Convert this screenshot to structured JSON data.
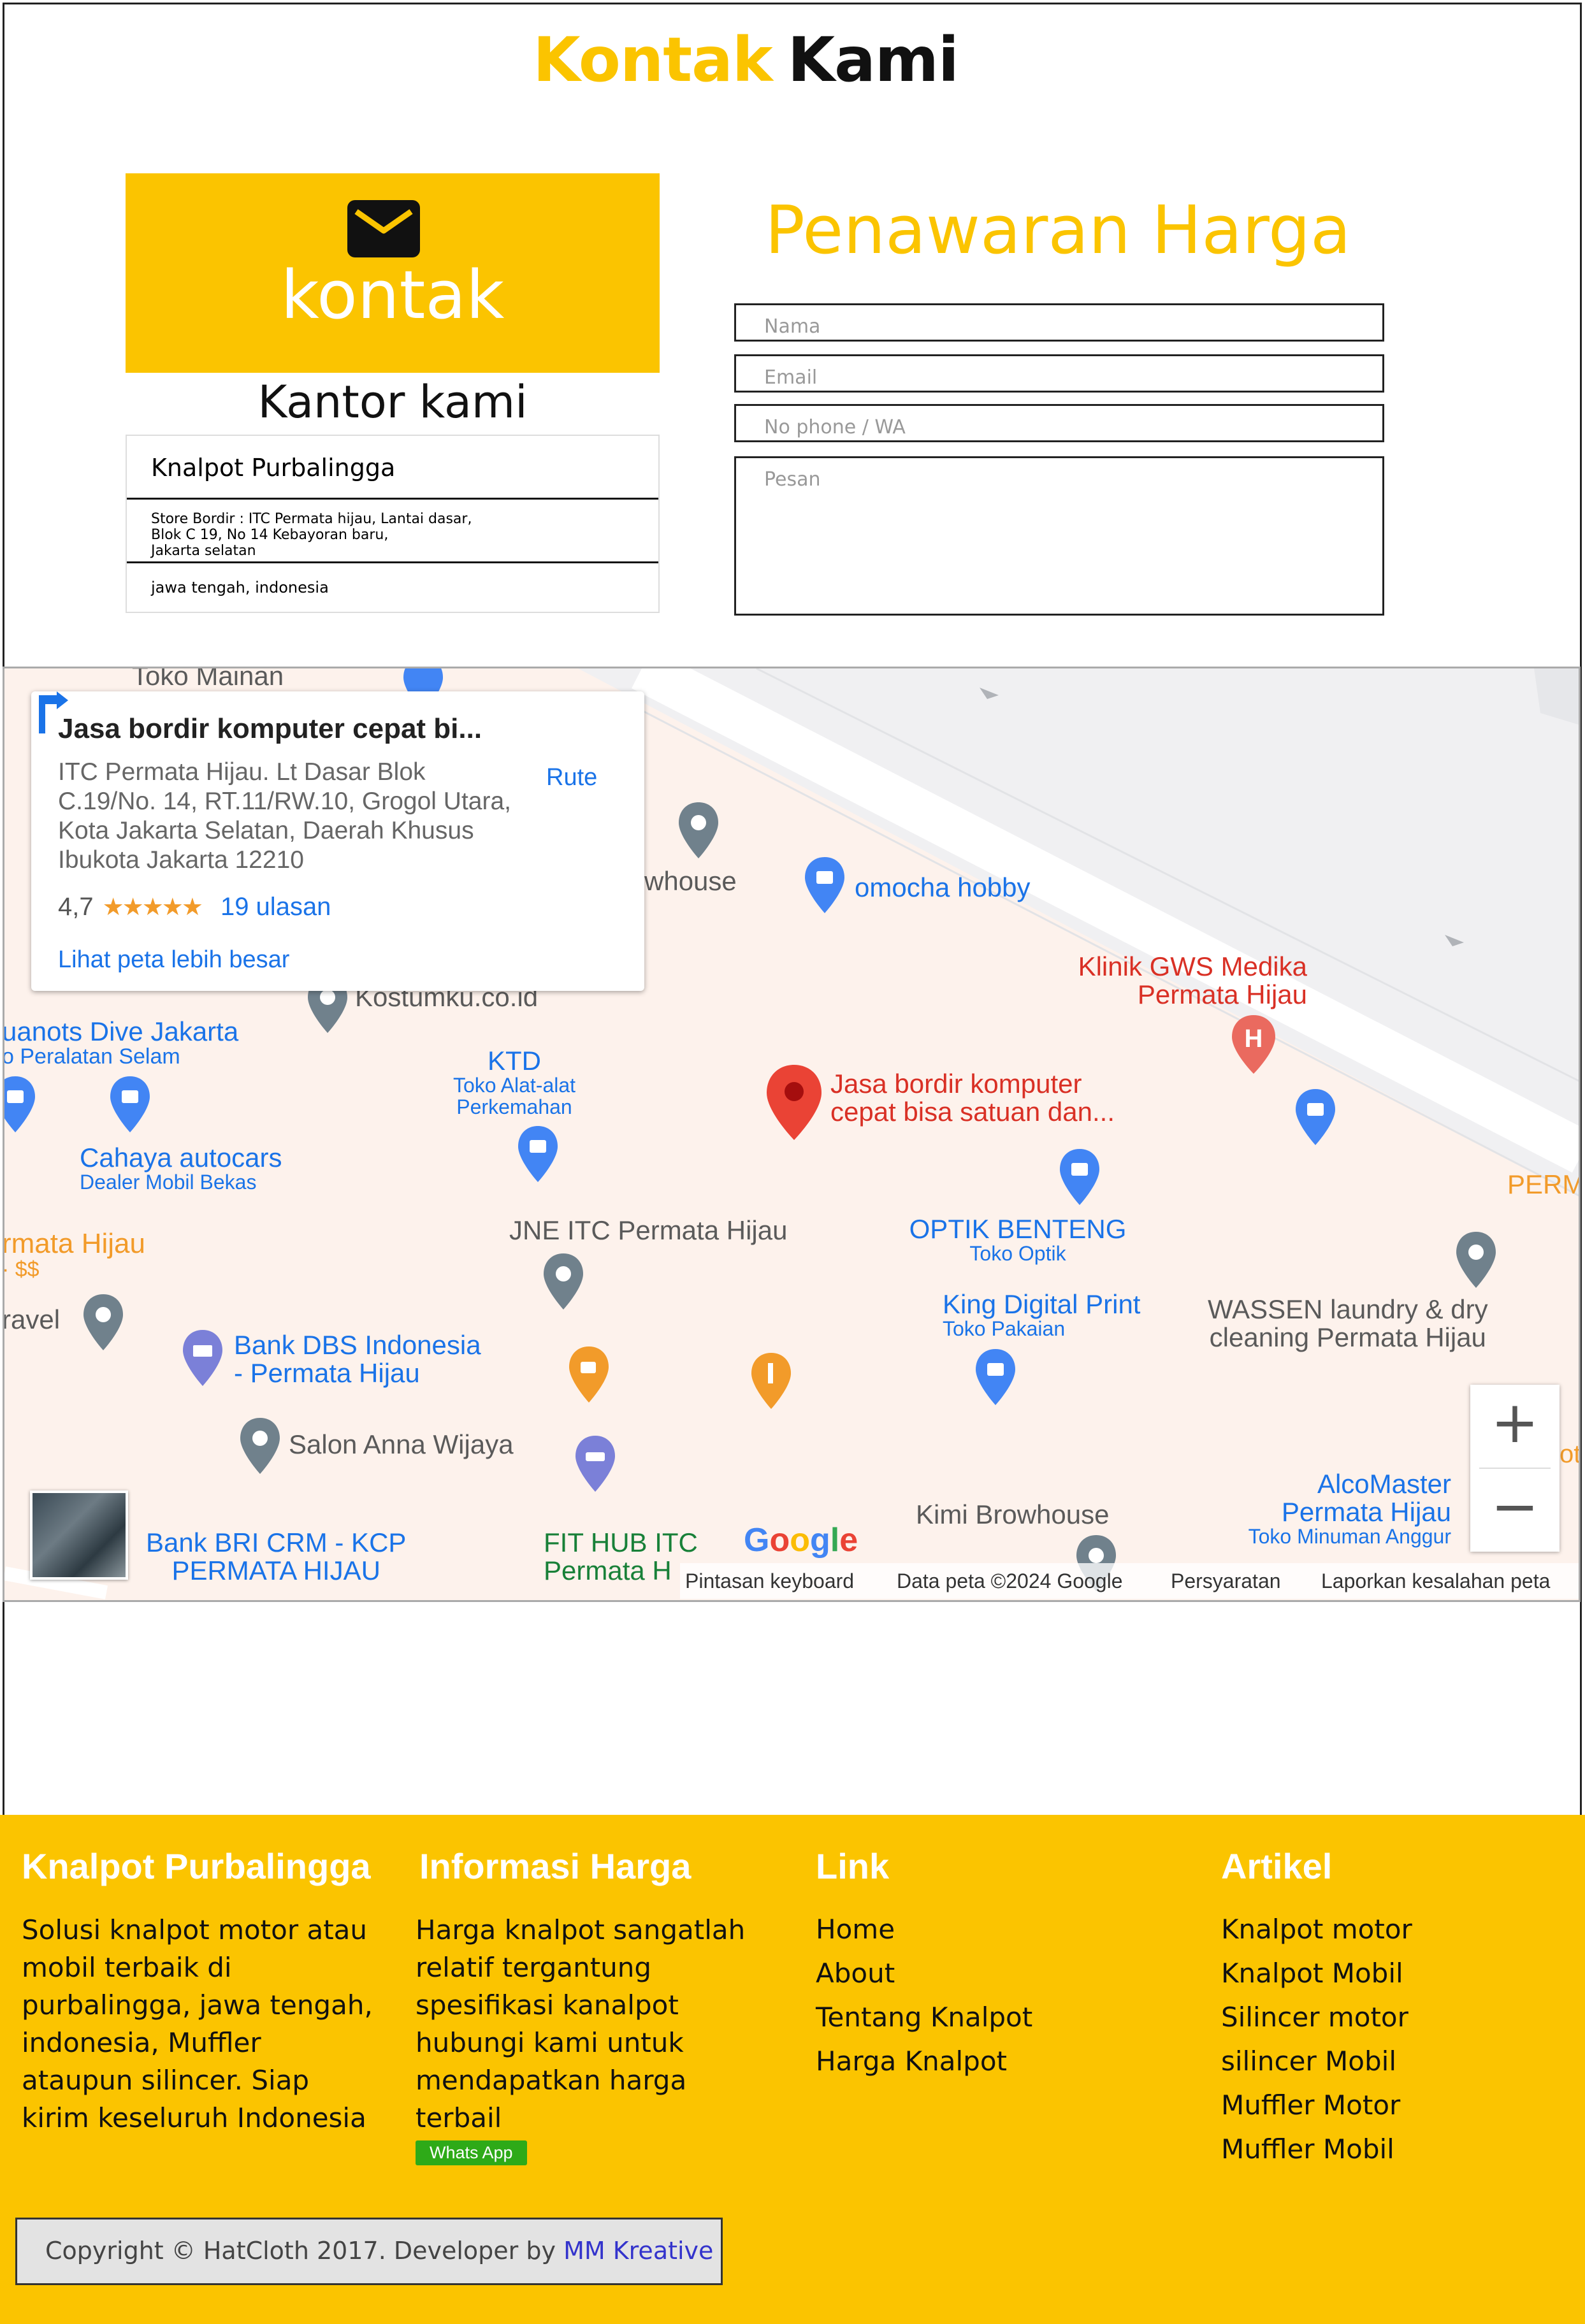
{
  "heading": {
    "part1": "Kontak",
    "part2": "Kami"
  },
  "contact": {
    "icon": "envelope-icon",
    "label": "kontak",
    "office_title": "Kantor kami",
    "rows": [
      "Knalpot Purbalingga",
      "Store Bordir : ITC Permata hijau, Lantai dasar,",
      "Blok C 19, No 14 Kebayoran baru,",
      "Jakarta selatan",
      "jawa tengah, indonesia"
    ]
  },
  "quote_form": {
    "title": "Penawaran Harga",
    "name_placeholder": "Nama",
    "email_placeholder": "Email",
    "phone_placeholder": "No phone / WA",
    "message_placeholder": "Pesan"
  },
  "map": {
    "place_card": {
      "title": "Jasa bordir komputer cepat bi...",
      "address": "ITC Permata Hijau. Lt Dasar Blok C.19/No. 14, RT.11/RW.10, Grogol Utara, Kota Jakarta Selatan, Daerah Khusus Ibukota Jakarta 12210",
      "rating": "4,7",
      "stars": "★★★★★",
      "reviews": "19 ulasan",
      "larger_map": "Lihat peta lebih besar",
      "route": "Rute"
    },
    "labels": {
      "toko_mainan": "Toko Mainan",
      "whouse": "whouse",
      "omocha": "omocha hobby",
      "klinik_1": "Klinik GWS Medika",
      "klinik_2": "Permata Hijau",
      "kostumku": "Kostumku.co.id",
      "dive_1": "uanots Dive Jakarta",
      "dive_2": "o Peralatan Selam",
      "ktd": "KTD",
      "ktd_sub_1": "Toko Alat-alat",
      "ktd_sub_2": "Perkemahan",
      "jasa_1": "Jasa bordir komputer",
      "jasa_2": "cepat bisa satuan dan...",
      "cahaya": "Cahaya autocars",
      "cahaya_sub": "Dealer Mobil Bekas",
      "rmata": "rmata Hijau",
      "rmata_sub": "· $$",
      "jne": "JNE ITC Permata Hijau",
      "optik": "OPTIK BENTENG",
      "optik_sub": "Toko Optik",
      "perm": "PERM",
      "ravel": "ravel",
      "king": "King Digital Print",
      "king_sub": "Toko Pakaian",
      "wassen_1": "WASSEN laundry & dry",
      "wassen_2": "cleaning Permata Hijau",
      "dbs_1": "Bank DBS Indonesia",
      "dbs_2": "- Permata Hijau",
      "salon": "Salon Anna Wijaya",
      "alco_1": "AlcoMaster",
      "alco_2": "Permata Hijau",
      "alco_sub": "Toko Minuman Anggur",
      "bri_1": "Bank BRI CRM - KCP",
      "bri_2": "PERMATA HIJAU",
      "fit_1": "FIT HUB ITC",
      "fit_2": "Permata H",
      "kimi": "Kimi Browhouse",
      "oti": "oti"
    },
    "google": "Google",
    "attribution": [
      "Pintasan keyboard",
      "Data peta ©2024 Google",
      "Persyaratan",
      "Laporkan kesalahan peta"
    ],
    "zoom_in": "+",
    "zoom_out": "−",
    "colors": {
      "road": "#ffffff",
      "land": "#fdf2ec",
      "pin_red": "#ea4335",
      "pin_blue": "#4285f4",
      "pin_gray": "#70818c",
      "pin_orange": "#f29b2a",
      "pin_purple": "#7b80d8"
    }
  },
  "footer": {
    "col1_title": "Knalpot Purbalingga",
    "col1_text": [
      "Solusi knalpot motor atau",
      "mobil terbaik di",
      "purbalingga, jawa tengah,",
      "indonesia, Muffler",
      "ataupun silincer. Siap",
      "kirim keseluruh Indonesia"
    ],
    "col2_title": "Informasi Harga",
    "col2_text": [
      "Harga knalpot sangatlah",
      "relatif tergantung",
      "spesifikasi kanalpot",
      "hubungi kami untuk",
      "mendapatkan harga",
      "terbail"
    ],
    "whatsapp": "Whats App",
    "col3_title": "Link",
    "links": [
      "Home",
      "About",
      "Tentang Knalpot",
      "Harga Knalpot"
    ],
    "col4_title": "Artikel",
    "articles": [
      "Knalpot motor",
      "Knalpot Mobil",
      "Silincer motor",
      "silincer Mobil",
      "Muffler Motor",
      "Muffler Mobil"
    ],
    "copyright_text": "Copyright © HatCloth 2017. Developer by ",
    "developer": "MM Kreative"
  },
  "colors": {
    "accent": "#fbc400",
    "whatsapp": "#2eaa18"
  }
}
